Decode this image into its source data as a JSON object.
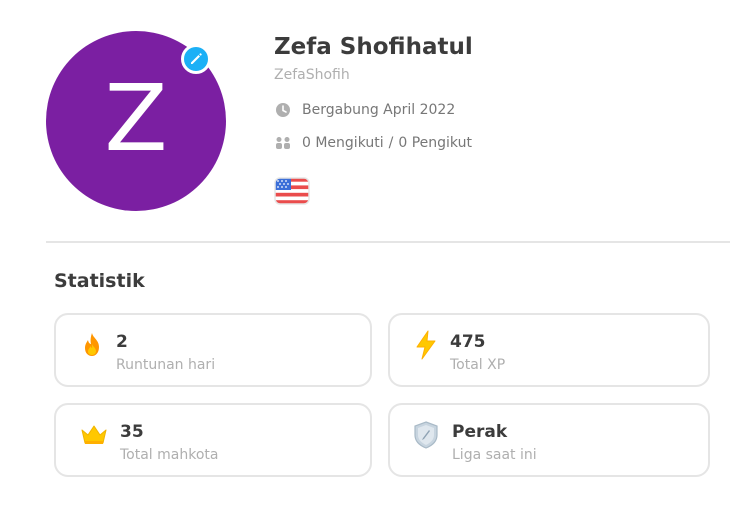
{
  "profile": {
    "avatar_letter": "Z",
    "name": "Zefa Shofihatul",
    "username": "ZefaShofih",
    "joined": "Bergabung April 2022",
    "following": "0 Mengikuti",
    "separator": "/",
    "followers": "0 Pengikut",
    "avatar_color": "#7b1fa2",
    "flag": "us-flag-icon"
  },
  "statistics": {
    "title": "Statistik",
    "cards": [
      {
        "value": "2",
        "label": "Runtunan hari",
        "icon": "fire-icon"
      },
      {
        "value": "475",
        "label": "Total XP",
        "icon": "lightning-icon"
      },
      {
        "value": "35",
        "label": "Total mahkota",
        "icon": "crown-icon"
      },
      {
        "value": "Perak",
        "label": "Liga saat ini",
        "icon": "silver-league-icon"
      }
    ]
  },
  "colors": {
    "accent_blue": "#1cb0f6",
    "fire_orange": "#ff9600",
    "xp_yellow": "#ffc800",
    "border": "#e5e5e5",
    "muted_text": "#afafaf"
  }
}
